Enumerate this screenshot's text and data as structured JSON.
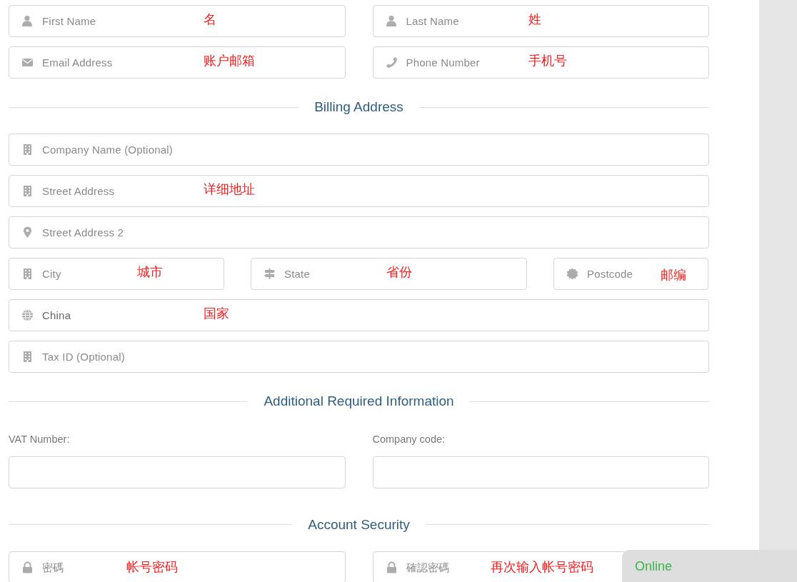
{
  "sections": [
    {
      "kind": "fields",
      "rows": [
        [
          {
            "kind": "person",
            "placeholder": "First Name",
            "note": "名"
          },
          {
            "kind": "person",
            "placeholder": "Last Name",
            "note": "姓"
          }
        ],
        [
          {
            "kind": "envelope",
            "placeholder": "Email Address",
            "note": "账户邮箱"
          },
          {
            "kind": "phone",
            "placeholder": "Phone Number",
            "note": "手机号"
          }
        ]
      ]
    },
    {
      "kind": "heading",
      "title": "Billing Address"
    },
    {
      "kind": "fields",
      "rows": [
        [
          {
            "kind": "building",
            "placeholder": "Company Name (Optional)"
          }
        ],
        [
          {
            "kind": "building",
            "placeholder": "Street Address",
            "note": "详细地址"
          }
        ],
        [
          {
            "kind": "pin",
            "placeholder": "Street Address 2"
          }
        ],
        [
          {
            "kind": "building",
            "placeholder": "City",
            "note": "城市"
          },
          {
            "kind": "signpost",
            "placeholder": "State",
            "note": "省份"
          },
          {
            "kind": "seal",
            "placeholder": "Postcode",
            "note": "邮编"
          }
        ],
        [
          {
            "kind": "globe",
            "value": "China",
            "note": "国家"
          }
        ],
        [
          {
            "kind": "building",
            "placeholder": "Tax ID (Optional)"
          }
        ]
      ]
    },
    {
      "kind": "heading",
      "title": "Additional Required Information"
    },
    {
      "kind": "labeled",
      "rows": [
        [
          {
            "label": "VAT Number:"
          },
          {
            "label": "Company code:"
          }
        ]
      ]
    },
    {
      "kind": "heading",
      "title": "Account Security"
    },
    {
      "kind": "fields",
      "rows": [
        [
          {
            "kind": "lock",
            "placeholder": "密碼",
            "note": "帐号密码"
          },
          {
            "kind": "lock",
            "placeholder": "確認密碼",
            "note": "再次输入帐号密码"
          }
        ]
      ]
    }
  ],
  "chat_widget": {
    "status": "Online"
  }
}
